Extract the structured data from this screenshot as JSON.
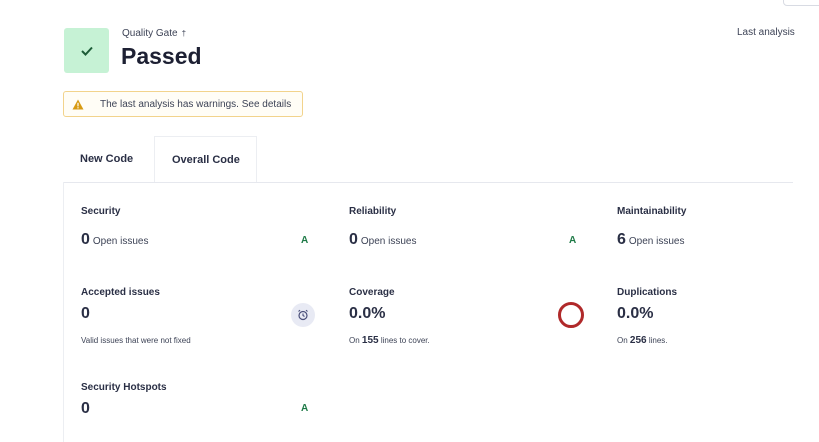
{
  "quality_gate": {
    "label": "Quality Gate",
    "info_glyph": "†",
    "status": "Passed",
    "status_color": "#c6f2d5",
    "last_analysis_label": "Last analysis"
  },
  "warning": {
    "text": "The last analysis has warnings. See details",
    "color": "#f2d38c"
  },
  "tabs": [
    {
      "label": "New Code",
      "active": false
    },
    {
      "label": "Overall Code",
      "active": true
    }
  ],
  "metrics": {
    "security": {
      "title": "Security",
      "value": "0",
      "unit": "Open issues",
      "rating": "A"
    },
    "reliability": {
      "title": "Reliability",
      "value": "0",
      "unit": "Open issues",
      "rating": "A"
    },
    "maintainability": {
      "title": "Maintainability",
      "value": "6",
      "unit": "Open issues"
    },
    "accepted": {
      "title": "Accepted issues",
      "value": "0",
      "note": "Valid issues that were not fixed"
    },
    "coverage": {
      "title": "Coverage",
      "value": "0.0%",
      "on": "On",
      "lines": "155",
      "suffix": "lines to cover."
    },
    "duplications": {
      "title": "Duplications",
      "value": "0.0%",
      "on": "On",
      "lines": "256",
      "suffix": "lines."
    },
    "hotspots": {
      "title": "Security Hotspots",
      "value": "0",
      "rating": "A"
    }
  },
  "colors": {
    "rating_a": "#1e7a47",
    "coverage_ring": "#b0292a"
  }
}
